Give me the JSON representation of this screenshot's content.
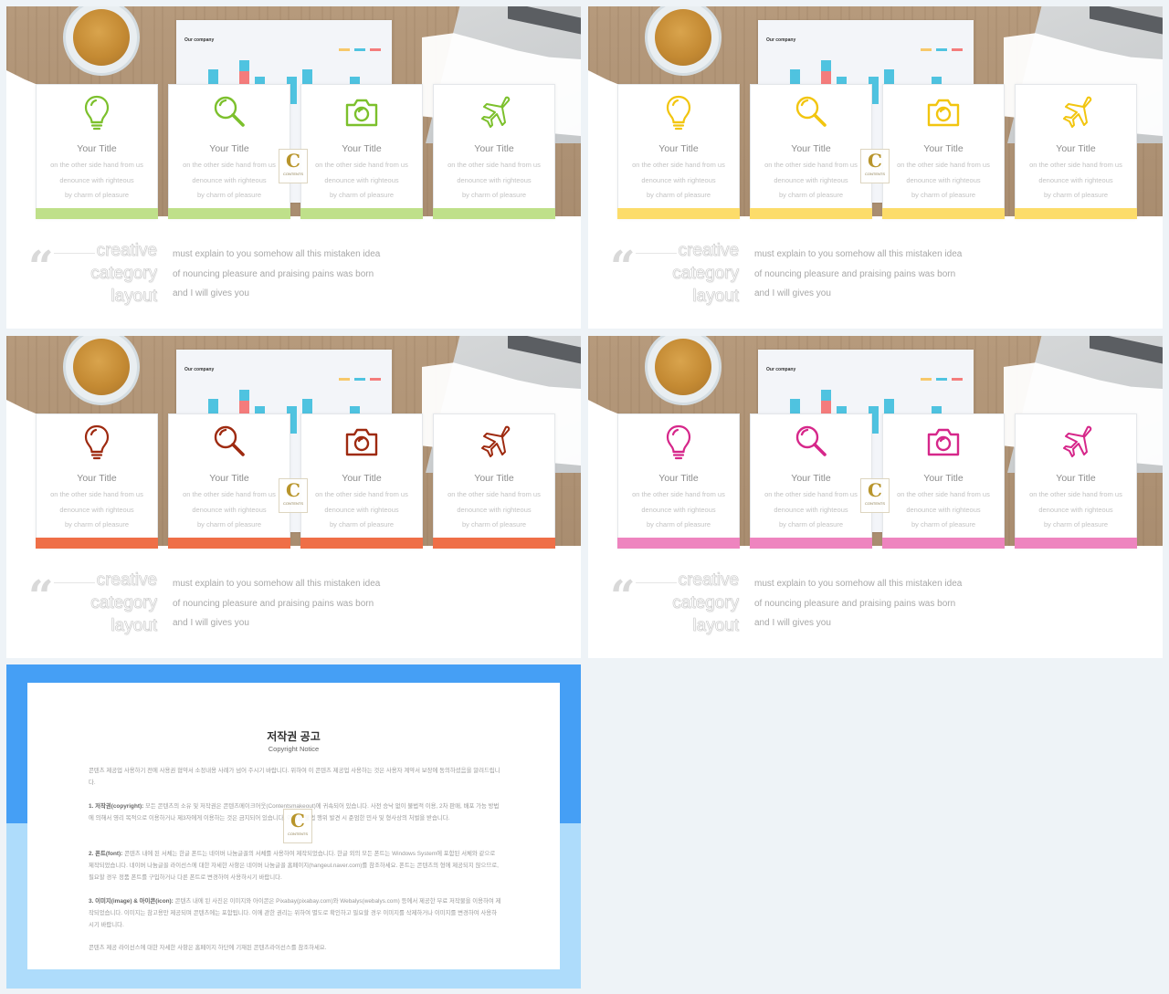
{
  "slides": [
    {
      "theme": "green",
      "accent": "#7cc02c",
      "bar_color": "#bfe08a",
      "cards": [
        {
          "icon": "lightbulb-icon",
          "title": "Your Title",
          "lines": [
            "on the other side hand from us",
            "denounce with righteous",
            "by charm of pleasure"
          ]
        },
        {
          "icon": "magnifier-icon",
          "title": "Your Title",
          "lines": [
            "on the other side hand from us",
            "denounce with righteous",
            "by charm of pleasure"
          ]
        },
        {
          "icon": "camera-icon",
          "title": "Your Title",
          "lines": [
            "on the other side hand from us",
            "denounce with righteous",
            "by charm of pleasure"
          ]
        },
        {
          "icon": "airplane-icon",
          "title": "Your Title",
          "lines": [
            "on the other side hand from us",
            "denounce with righteous",
            "by charm of pleasure"
          ]
        }
      ],
      "quote_heading": [
        "creative",
        "category",
        "layout"
      ],
      "quote_text": [
        "must explain to you somehow all this mistaken idea",
        "of nouncing pleasure and praising pains was born",
        "and I will gives you"
      ]
    },
    {
      "theme": "yellow",
      "accent": "#f2c50f",
      "bar_color": "#fcdc6a",
      "cards": [
        {
          "icon": "lightbulb-icon",
          "title": "Your Title",
          "lines": [
            "on the other side hand from us",
            "denounce with righteous",
            "by charm of pleasure"
          ]
        },
        {
          "icon": "magnifier-icon",
          "title": "Your Title",
          "lines": [
            "on the other side hand from us",
            "denounce with righteous",
            "by charm of pleasure"
          ]
        },
        {
          "icon": "camera-icon",
          "title": "Your Title",
          "lines": [
            "on the other side hand from us",
            "denounce with righteous",
            "by charm of pleasure"
          ]
        },
        {
          "icon": "airplane-icon",
          "title": "Your Title",
          "lines": [
            "on the other side hand from us",
            "denounce with righteous",
            "by charm of pleasure"
          ]
        }
      ],
      "quote_heading": [
        "creative",
        "category",
        "layout"
      ],
      "quote_text": [
        "must explain to you somehow all this mistaken idea",
        "of nouncing pleasure and praising pains was born",
        "and I will gives you"
      ]
    },
    {
      "theme": "orange",
      "accent": "#9e2a10",
      "bar_color": "#ef6f47",
      "cards": [
        {
          "icon": "lightbulb-icon",
          "title": "Your Title",
          "lines": [
            "on the other side hand from us",
            "denounce with righteous",
            "by charm of pleasure"
          ]
        },
        {
          "icon": "magnifier-icon",
          "title": "Your Title",
          "lines": [
            "on the other side hand from us",
            "denounce with righteous",
            "by charm of pleasure"
          ]
        },
        {
          "icon": "camera-icon",
          "title": "Your Title",
          "lines": [
            "on the other side hand from us",
            "denounce with righteous",
            "by charm of pleasure"
          ]
        },
        {
          "icon": "airplane-icon",
          "title": "Your Title",
          "lines": [
            "on the other side hand from us",
            "denounce with righteous",
            "by charm of pleasure"
          ]
        }
      ],
      "quote_heading": [
        "creative",
        "category",
        "layout"
      ],
      "quote_text": [
        "must explain to you somehow all this mistaken idea",
        "of nouncing pleasure and praising pains was born",
        "and I will gives you"
      ]
    },
    {
      "theme": "pink",
      "accent": "#d6278a",
      "bar_color": "#ee84bf",
      "cards": [
        {
          "icon": "lightbulb-icon",
          "title": "Your Title",
          "lines": [
            "on the other side hand from us",
            "denounce with righteous",
            "by charm of pleasure"
          ]
        },
        {
          "icon": "magnifier-icon",
          "title": "Your Title",
          "lines": [
            "on the other side hand from us",
            "denounce with righteous",
            "by charm of pleasure"
          ]
        },
        {
          "icon": "camera-icon",
          "title": "Your Title",
          "lines": [
            "on the other side hand from us",
            "denounce with righteous",
            "by charm of pleasure"
          ]
        },
        {
          "icon": "airplane-icon",
          "title": "Your Title",
          "lines": [
            "on the other side hand from us",
            "denounce with righteous",
            "by charm of pleasure"
          ]
        }
      ],
      "quote_heading": [
        "creative",
        "category",
        "layout"
      ],
      "quote_text": [
        "must explain to you somehow all this mistaken idea",
        "of nouncing pleasure and praising pains was born",
        "and I will gives you"
      ]
    }
  ],
  "background_paper": {
    "title": "Our company",
    "legend_colors": [
      "#f7c86a",
      "#4fc3e0",
      "#f47c7c"
    ]
  },
  "watermark": {
    "letter": "C",
    "text": "CONTENTS"
  },
  "copyright": {
    "title": "저작권 공고",
    "subtitle": "Copyright Notice",
    "colors": {
      "top": "#459ff5",
      "bottom": "#aedcfb"
    },
    "intro": "콘텐츠 제공업 사용하기 전에 사용권 협약서 소정내용 사례가 넘어 주시기 바랍니다. 위하여 이 콘텐츠 제공업 사용하는 것은 사용자 계약서 보장에 동의하셨음을 알려드립니다.",
    "sections": [
      {
        "label": "1. 저작권(copyright):",
        "text": "모든 콘텐츠의 소유 및 저작권은 콘텐츠메이크어웃(Contentsmakeout)에 귀속되어 있습니다. 사전 승낙 없이 불법적 이용, 2차 판매, 배포 가능 방법에 의해서 영리 목적으로 이용하거나 제3자에게 이용하는 것은 금지되어 있습니다. 이러한 불법 행위 발견 시 준엄한 민사 및 형사상의 처벌을 받습니다."
      },
      {
        "label": "2. 폰트(font):",
        "text": "콘텐츠 내에 된 서체는 한글 폰트는 네이버 나눔글꼴의 서체를 사용하여 제작되었습니다. 한글 외의 모든 폰트는 Windows System에 포함된 서체와 같으로 제작되었습니다. 네이버 나눔글꼴 라이선스에 대한 자세한 사항은 네이버 나눔글꼴 홈페이지(hangeul.naver.com)를 참조하세요. 폰트는 콘텐츠의 형에 제공되지 않으므로, 필요할 경우 정품 폰트를 구입하거나 다른 폰트로 변경하여 사용하시기 바랍니다."
      },
      {
        "label": "3. 이미지(image) & 아이콘(icon):",
        "text": "콘텐츠 내에 된 사진은 이미지와 아이콘은 Pixabay(pixabay.com)와 Webalys(webalys.com) 등에서 제공한 무료 저작물을 이용하여 제작되었습니다. 이미지는 참고용만 제공되며 콘텐츠에는 포함됩니다. 이에 관한 권리는 위하여 별도로 확인하고 필요할 경우 이미지를 삭제하거나 이미지를 변경하여 사용하시기 바랍니다."
      }
    ],
    "footer": "콘텐츠 제공 라이선스에 대한 자세한 사항은 홈페이지 하단에 기재된 콘텐츠라이선스를 참조하세요."
  }
}
